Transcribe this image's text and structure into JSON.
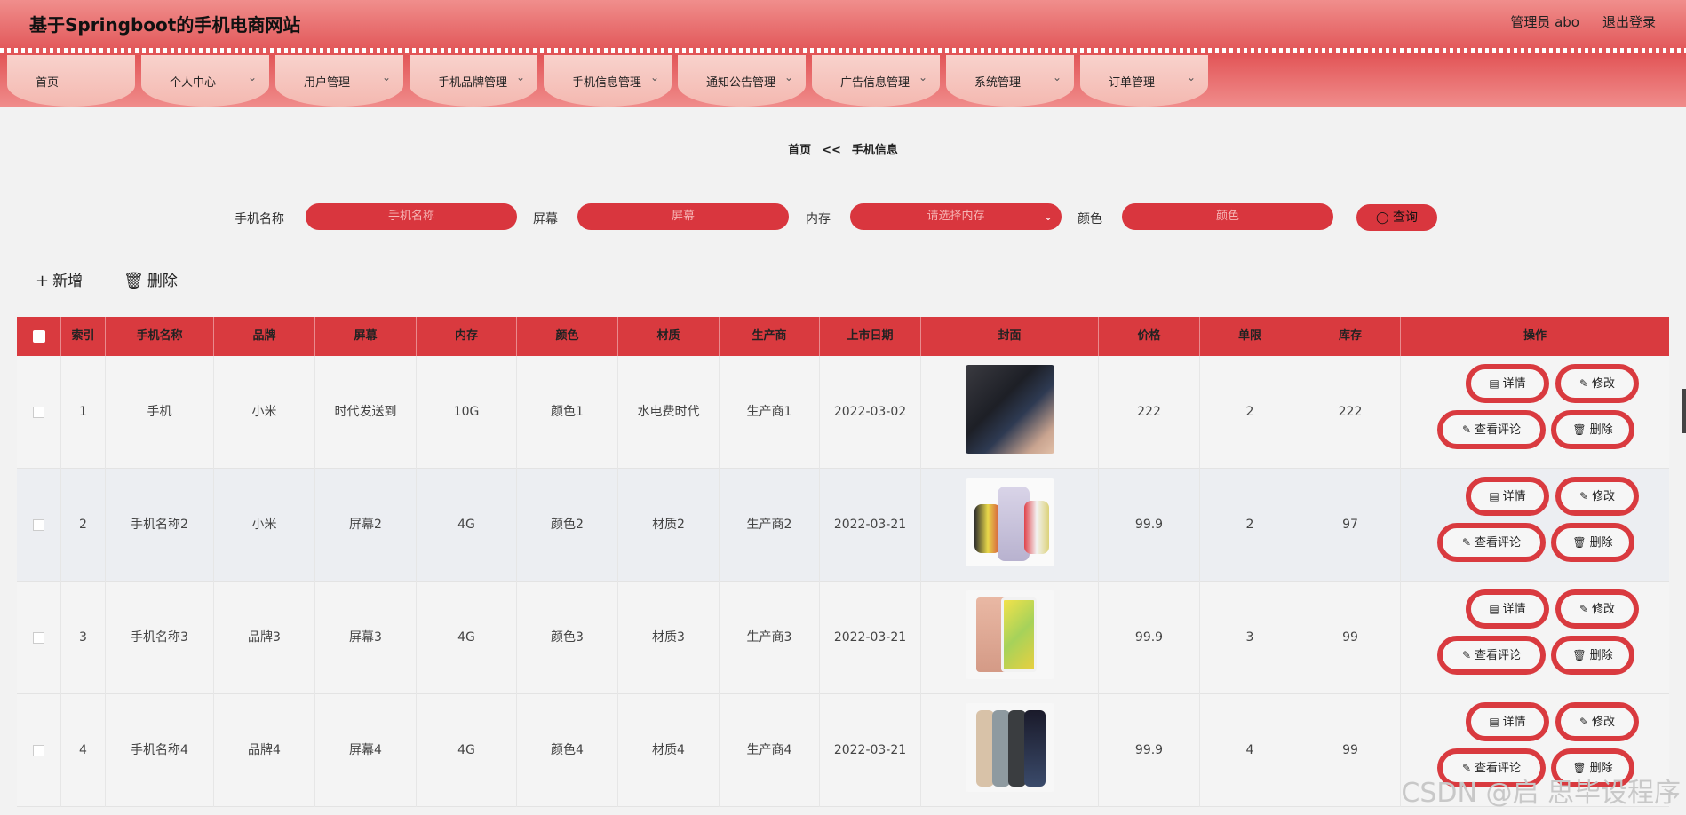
{
  "header": {
    "title": "基于Springboot的手机电商网站",
    "user": "管理员 abo",
    "logout": "退出登录"
  },
  "nav": [
    {
      "label": "首页",
      "chevron": false
    },
    {
      "label": "个人中心",
      "chevron": true
    },
    {
      "label": "用户管理",
      "chevron": true
    },
    {
      "label": "手机品牌管理",
      "chevron": true
    },
    {
      "label": "手机信息管理",
      "chevron": true
    },
    {
      "label": "通知公告管理",
      "chevron": true
    },
    {
      "label": "广告信息管理",
      "chevron": true
    },
    {
      "label": "系统管理",
      "chevron": true
    },
    {
      "label": "订单管理",
      "chevron": true
    }
  ],
  "breadcrumb": {
    "home": "首页",
    "sep": "<<",
    "current": "手机信息"
  },
  "search": {
    "name_label": "手机名称",
    "name_placeholder": "手机名称",
    "screen_label": "屏幕",
    "screen_placeholder": "屏幕",
    "memory_label": "内存",
    "memory_placeholder": "请选择内存",
    "color_label": "颜色",
    "color_placeholder": "颜色",
    "query_button": "查询"
  },
  "actions": {
    "add": "新增",
    "delete": "删除"
  },
  "table": {
    "headers": [
      "索引",
      "手机名称",
      "品牌",
      "屏幕",
      "内存",
      "颜色",
      "材质",
      "生产商",
      "上市日期",
      "封面",
      "价格",
      "单限",
      "库存",
      "操作"
    ],
    "rows": [
      {
        "index": "1",
        "name": "手机",
        "brand": "小米",
        "screen": "时代发送到",
        "memory": "10G",
        "color": "颜色1",
        "material": "水电费时代",
        "maker": "生产商1",
        "date": "2022-03-02",
        "cover": "tablet-photo",
        "price": "222",
        "limit": "2",
        "stock": "222"
      },
      {
        "index": "2",
        "name": "手机名称2",
        "brand": "小米",
        "screen": "屏幕2",
        "memory": "4G",
        "color": "颜色2",
        "material": "材质2",
        "maker": "生产商2",
        "date": "2022-03-21",
        "cover": "iphone-colors-photo",
        "price": "99.9",
        "limit": "2",
        "stock": "97"
      },
      {
        "index": "3",
        "name": "手机名称3",
        "brand": "品牌3",
        "screen": "屏幕3",
        "memory": "4G",
        "color": "颜色3",
        "material": "材质3",
        "maker": "生产商3",
        "date": "2022-03-21",
        "cover": "oppo-phone-photo",
        "price": "99.9",
        "limit": "3",
        "stock": "99"
      },
      {
        "index": "4",
        "name": "手机名称4",
        "brand": "品牌4",
        "screen": "屏幕4",
        "memory": "4G",
        "color": "颜色4",
        "material": "材质4",
        "maker": "生产商4",
        "date": "2022-03-21",
        "cover": "iphone-pro-photo",
        "price": "99.9",
        "limit": "4",
        "stock": "99"
      }
    ],
    "row_buttons": {
      "detail": "详情",
      "edit": "修改",
      "comments": "查看评论",
      "delete": "删除"
    }
  },
  "watermark": "CSDN @启 思毕设程序",
  "colors": {
    "accent": "#d93a3f",
    "topbar": "#e2585a",
    "nav_tab": "#f6c4bd",
    "page_bg": "#f2f2f2"
  }
}
